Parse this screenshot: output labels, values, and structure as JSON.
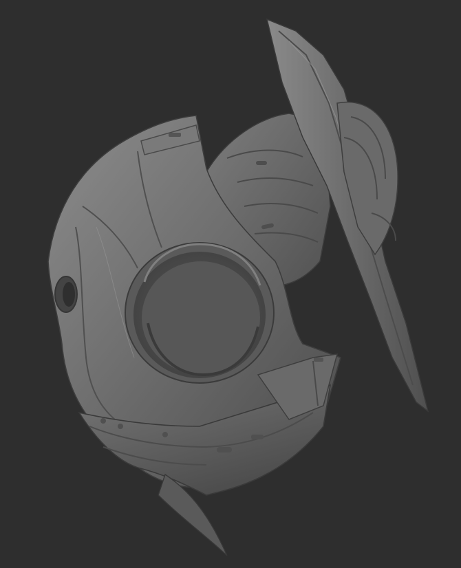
{
  "scene": {
    "background_color": "#2e2e2e",
    "clay_color": "#6e6e6e",
    "subject": "sculpt-viewport"
  }
}
